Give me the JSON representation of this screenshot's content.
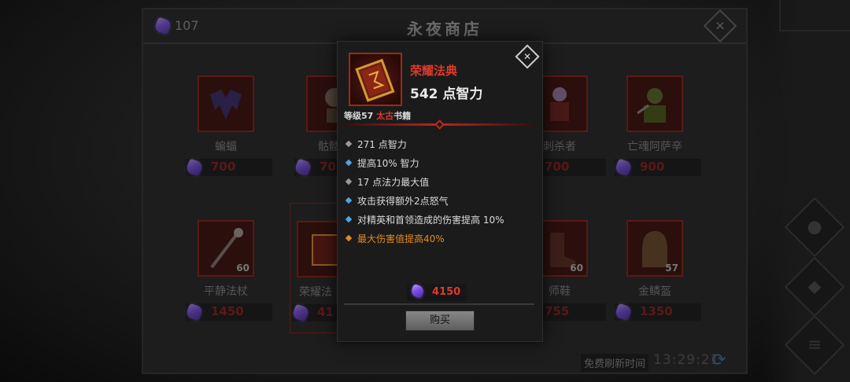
{
  "shop": {
    "title": "永夜商店",
    "currency_count": "107",
    "close_icon": "✕",
    "refresh_label": "免费刷新时间",
    "refresh_time": "13:29:21",
    "refresh_icon": "⟳",
    "items": [
      {
        "name": "蝙蝠",
        "price": "700",
        "level": "",
        "icon": "bat"
      },
      {
        "name": "骷髅战",
        "price": "70",
        "level": "",
        "icon": "skeleton"
      },
      {
        "name": "",
        "price": "",
        "level": "",
        "icon": "hidden"
      },
      {
        "name": "刺杀者",
        "price": "700",
        "level": "",
        "icon": "assassin"
      },
      {
        "name": "亡魂阿萨辛",
        "price": "900",
        "level": "",
        "icon": "ghost-assassin"
      },
      {
        "name": "平静法杖",
        "price": "1450",
        "level": "60",
        "icon": "staff"
      },
      {
        "name": "荣耀法",
        "price": "41",
        "level": "",
        "icon": "tome"
      },
      {
        "name": "",
        "price": "",
        "level": "",
        "icon": "hidden"
      },
      {
        "name": "师鞋",
        "price": "755",
        "level": "60",
        "icon": "boots"
      },
      {
        "name": "金鳞盔",
        "price": "1350",
        "level": "57",
        "icon": "helmet"
      }
    ]
  },
  "popup": {
    "item_name": "荣耀法典",
    "main_stat": "542 点智力",
    "level_prefix": "等级57",
    "rarity": "太古",
    "category": "书籍",
    "close_icon": "✕",
    "stats": [
      {
        "text": "271 点智力",
        "bullet": "grey"
      },
      {
        "text": "提高10% 智力",
        "bullet": "blue"
      },
      {
        "text": "17 点法力最大值",
        "bullet": "grey"
      },
      {
        "text": "攻击获得额外2点怒气",
        "bullet": "blue"
      },
      {
        "text": "对精英和首领造成的伤害提高 10%",
        "bullet": "blue"
      },
      {
        "text": "最大伤害值提高40%",
        "bullet": "orange"
      }
    ],
    "price": "4150",
    "buy_label": "购买"
  },
  "colors": {
    "accent_red": "#e03a2a",
    "gem_purple": "#7b4ee6",
    "legendary_orange": "#e08a22",
    "magic_blue": "#4aa6e6"
  }
}
